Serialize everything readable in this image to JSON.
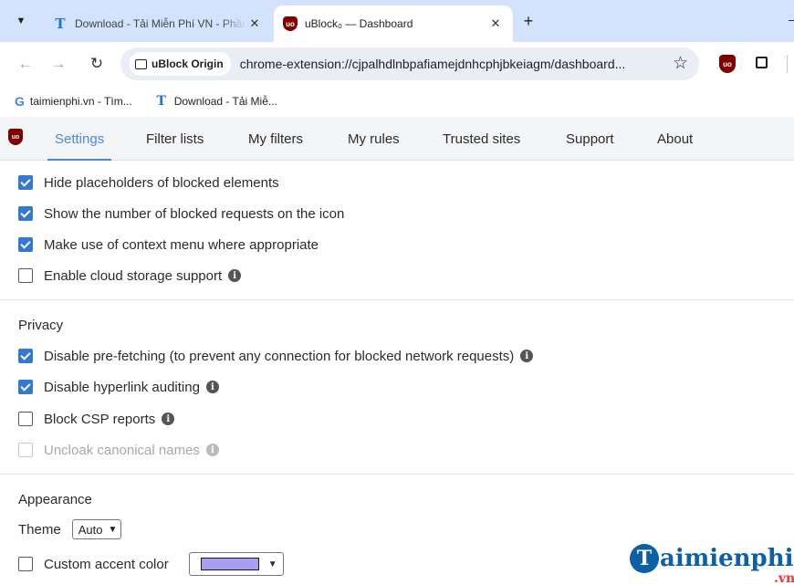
{
  "browser": {
    "tabs": [
      {
        "title": "Download - Tải Miễn Phí VN - Phần mềm",
        "favicon": "taimienphi-t-icon",
        "active": false
      },
      {
        "title": "uBlock₀ — Dashboard",
        "favicon": "ublock-icon",
        "active": true
      }
    ],
    "ublock_glyph": "uo",
    "new_tab_icon": "+",
    "omnibox": {
      "chip_label": "uBlock Origin",
      "url": "chrome-extension://cjpalhdlnbpafiamejdnhcphjbkeiagm/dashboard..."
    },
    "bookmarks": [
      {
        "label": "taimienphi.vn - Tìm...",
        "favicon": "google-g-icon"
      },
      {
        "label": "Download - Tải Miễ...",
        "favicon": "taimienphi-t-icon"
      }
    ]
  },
  "dashboard": {
    "tabs": [
      {
        "label": "Settings",
        "selected": true
      },
      {
        "label": "Filter lists",
        "selected": false
      },
      {
        "label": "My filters",
        "selected": false
      },
      {
        "label": "My rules",
        "selected": false
      },
      {
        "label": "Trusted sites",
        "selected": false
      },
      {
        "label": "Support",
        "selected": false
      },
      {
        "label": "About",
        "selected": false
      }
    ]
  },
  "settings": {
    "general": [
      {
        "label": "Hide placeholders of blocked elements",
        "checked": true
      },
      {
        "label": "Show the number of blocked requests on the icon",
        "checked": true
      },
      {
        "label": "Make use of context menu where appropriate",
        "checked": true
      },
      {
        "label": "Enable cloud storage support",
        "checked": false,
        "info": true
      }
    ],
    "privacy": {
      "title": "Privacy",
      "items": [
        {
          "label": "Disable pre-fetching (to prevent any connection for blocked network requests)",
          "checked": true,
          "info": true
        },
        {
          "label": "Disable hyperlink auditing",
          "checked": true,
          "info": true
        },
        {
          "label": "Block CSP reports",
          "checked": false,
          "info": true
        },
        {
          "label": "Uncloak canonical names",
          "checked": false,
          "info": true,
          "disabled": true
        }
      ]
    },
    "appearance": {
      "title": "Appearance",
      "theme_label": "Theme",
      "theme_value": "Auto",
      "custom_accent_label": "Custom accent color",
      "custom_accent_checked": false,
      "accent_color": "#a89ff0"
    }
  },
  "watermark": {
    "initial": "T",
    "text": "aimienphi",
    "suffix": ".vn"
  },
  "colors": {
    "accent": "#4a86e8",
    "checkbox": "#3478cf",
    "ublock_red": "#800000"
  }
}
